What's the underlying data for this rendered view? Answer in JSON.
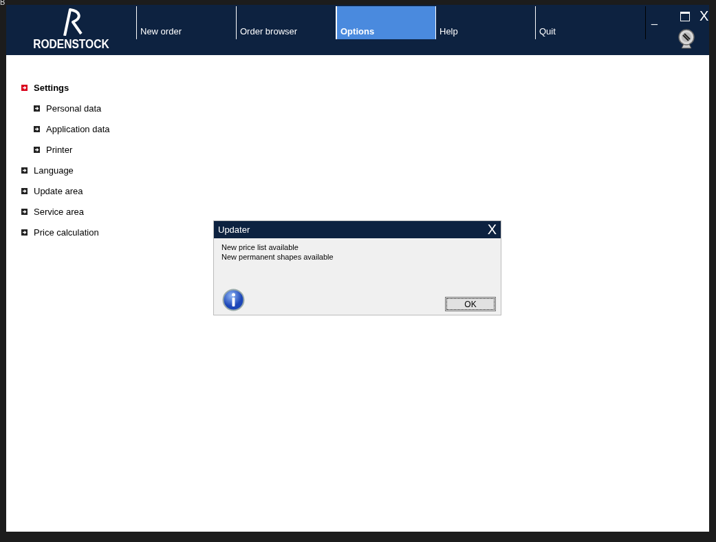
{
  "corner_text": "B",
  "logo": {
    "wordmark": "RODENSTOCK"
  },
  "nav": [
    {
      "label": "New order",
      "selected": false
    },
    {
      "label": "Order browser",
      "selected": false
    },
    {
      "label": "Options",
      "selected": true
    },
    {
      "label": "Help",
      "selected": false
    },
    {
      "label": "Quit",
      "selected": false
    }
  ],
  "window_controls": {
    "minimize": "_",
    "close": "X"
  },
  "tree": [
    {
      "label": "Settings",
      "selected": true,
      "children": [
        {
          "label": "Personal data",
          "selected": false
        },
        {
          "label": "Application data",
          "selected": false
        },
        {
          "label": "Printer",
          "selected": false
        }
      ]
    },
    {
      "label": "Language",
      "selected": false
    },
    {
      "label": "Update area",
      "selected": false
    },
    {
      "label": "Service area",
      "selected": false
    },
    {
      "label": "Price calculation",
      "selected": false
    }
  ],
  "dialog": {
    "title": "Updater",
    "close": "X",
    "messages": [
      "New price list available",
      "New permanent shapes available"
    ],
    "button": "OK"
  }
}
